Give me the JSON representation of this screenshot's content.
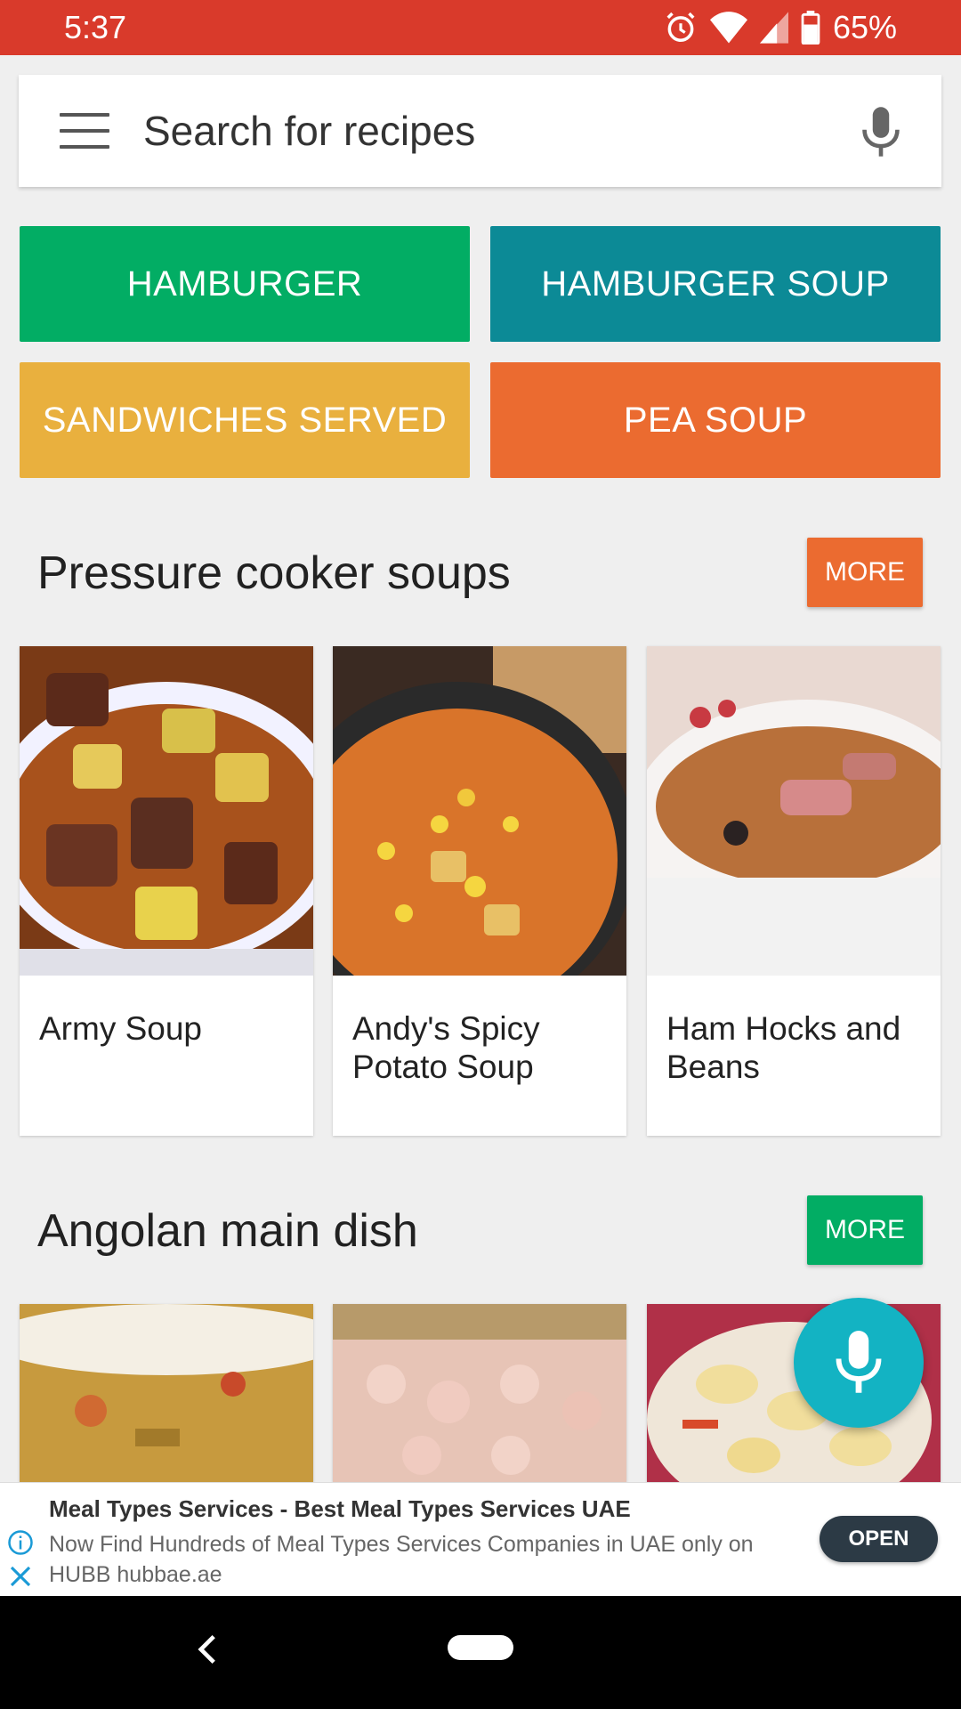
{
  "status_bar": {
    "time": "5:37",
    "battery": "65%"
  },
  "search": {
    "placeholder": "Search for recipes"
  },
  "tags": [
    {
      "label": "HAMBURGER",
      "color": "#02ad64"
    },
    {
      "label": "HAMBURGER SOUP",
      "color": "#0c8a96"
    },
    {
      "label": "SANDWICHES SERVED",
      "color": "#e9b03e"
    },
    {
      "label": "PEA SOUP",
      "color": "#eb6b30"
    }
  ],
  "sections": [
    {
      "title": "Pressure cooker soups",
      "more_label": "MORE",
      "more_color": "#eb6b30",
      "recipes": [
        {
          "title": "Army Soup"
        },
        {
          "title": "Andy's Spicy Potato Soup"
        },
        {
          "title": "Ham Hocks and Beans"
        }
      ]
    },
    {
      "title": "Angolan main dish",
      "more_label": "MORE",
      "more_color": "#02ad64"
    }
  ],
  "ad": {
    "title": "Meal Types Services - Best Meal Types Services UAE",
    "body": "Now Find Hundreds of Meal Types Services Companies in UAE only on HUBB hubbae.ae",
    "cta": "OPEN"
  },
  "icons": [
    "alarm-icon",
    "wifi-icon",
    "signal-icon",
    "battery-icon",
    "menu-icon",
    "mic-icon",
    "info-icon",
    "close-icon",
    "back-icon",
    "home-icon"
  ]
}
